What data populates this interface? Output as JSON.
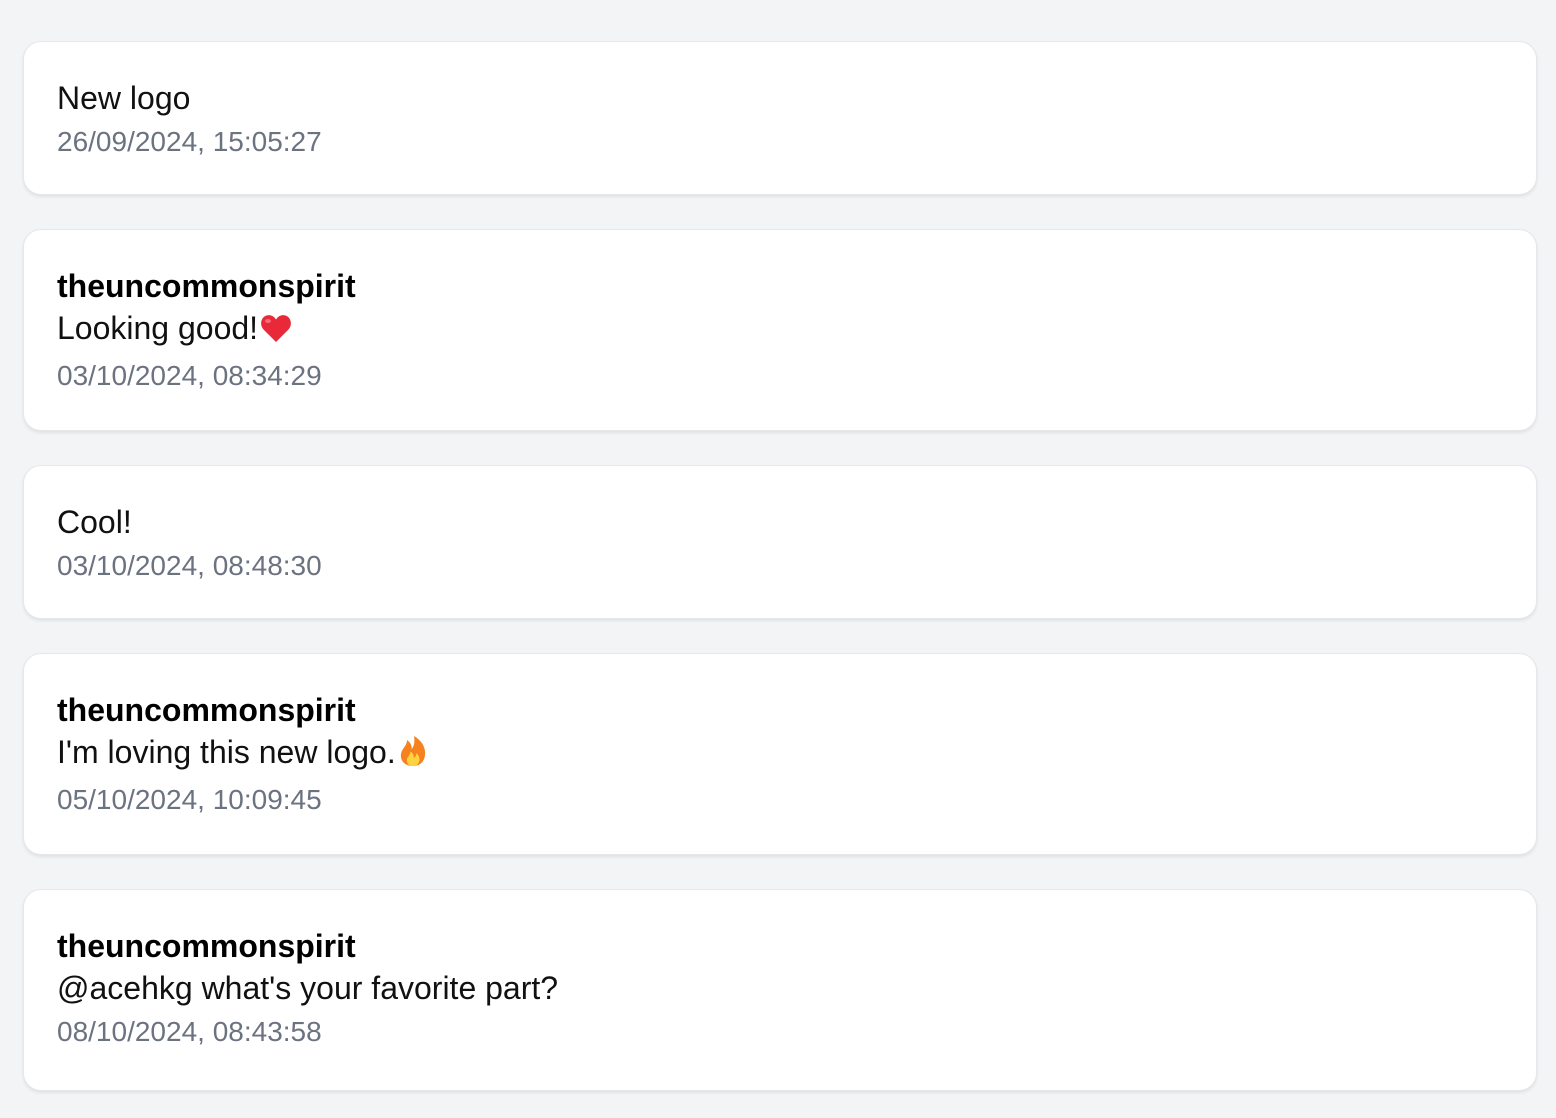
{
  "comments": [
    {
      "author": "",
      "text": "New logo",
      "timestamp": "26/09/2024, 15:05:27"
    },
    {
      "author": "theuncommonspirit",
      "text": "Looking good!",
      "emoji": "heart-icon",
      "timestamp": "03/10/2024, 08:34:29"
    },
    {
      "author": "",
      "text": "Cool!",
      "timestamp": "03/10/2024, 08:48:30"
    },
    {
      "author": "theuncommonspirit",
      "text": "I'm loving this new logo.",
      "emoji": "fire-icon",
      "timestamp": "05/10/2024, 10:09:45"
    },
    {
      "author": "theuncommonspirit",
      "text": "@acehkg what's your favorite part?",
      "timestamp": "08/10/2024, 08:43:58"
    }
  ],
  "colors": {
    "background": "#f3f4f6",
    "card": "#ffffff",
    "timestamp": "#6b7280",
    "heart": "#e8293a",
    "fire": "#f5821f"
  }
}
